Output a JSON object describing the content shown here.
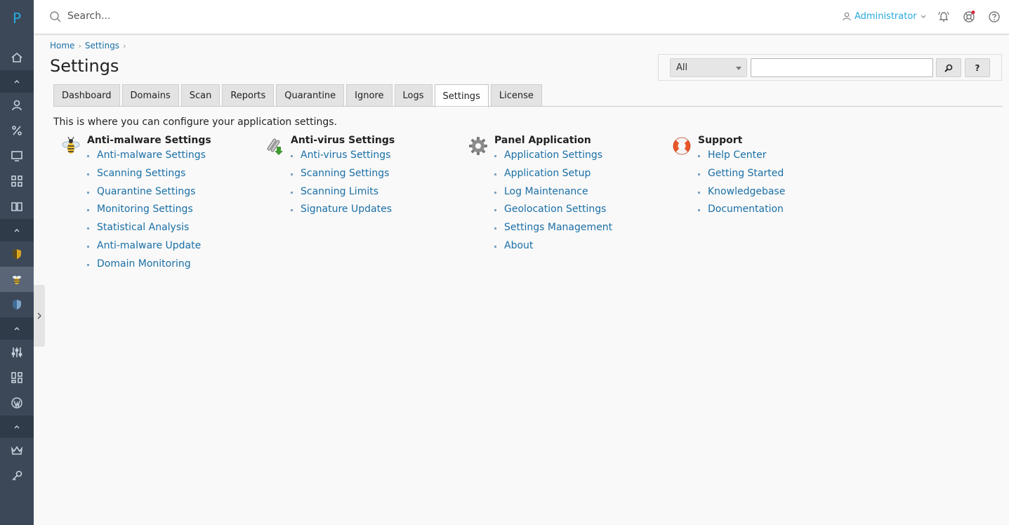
{
  "sidebar": {
    "logo": "P",
    "items": [
      {
        "name": "home-icon"
      },
      {
        "name": "user-icon"
      },
      {
        "name": "percent-icon"
      },
      {
        "name": "monitor-icon"
      },
      {
        "name": "apps-grid-icon"
      },
      {
        "name": "book-icon"
      },
      {
        "name": "shield-yellow-icon"
      },
      {
        "name": "bee-icon"
      },
      {
        "name": "shield-blue-icon"
      },
      {
        "name": "sliders-icon"
      },
      {
        "name": "modules-icon"
      },
      {
        "name": "wordpress-icon"
      },
      {
        "name": "crown-icon"
      },
      {
        "name": "key-icon"
      }
    ],
    "colors": {
      "bg": "#3c4858",
      "accent": "#28aade"
    }
  },
  "header": {
    "search_placeholder": "Search...",
    "user_label": "Administrator",
    "icons": [
      "notifications-icon",
      "help-wheel-icon",
      "question-icon"
    ]
  },
  "breadcrumb": {
    "home": "Home",
    "settings": "Settings"
  },
  "page": {
    "title": "Settings",
    "intro": "This is where you can configure your application settings."
  },
  "filter": {
    "select_value": "All",
    "search_button_icon": "search-icon",
    "help_button_label": "?"
  },
  "tabs": [
    {
      "label": "Dashboard",
      "active": false
    },
    {
      "label": "Domains",
      "active": false
    },
    {
      "label": "Scan",
      "active": false
    },
    {
      "label": "Reports",
      "active": false
    },
    {
      "label": "Quarantine",
      "active": false
    },
    {
      "label": "Ignore",
      "active": false
    },
    {
      "label": "Logs",
      "active": false
    },
    {
      "label": "Settings",
      "active": true
    },
    {
      "label": "License",
      "active": false
    }
  ],
  "sections": [
    {
      "title": "Anti-malware Settings",
      "icon": "bee-icon",
      "links": [
        "Anti-malware Settings",
        "Scanning Settings",
        "Quarantine Settings",
        "Monitoring Settings",
        "Statistical Analysis",
        "Anti-malware Update",
        "Domain Monitoring"
      ]
    },
    {
      "title": "Anti-virus Settings",
      "icon": "chain-download-icon",
      "links": [
        "Anti-virus Settings",
        "Scanning Settings",
        "Scanning Limits",
        "Signature Updates"
      ]
    },
    {
      "title": "Panel Application",
      "icon": "gear-icon",
      "links": [
        "Application Settings",
        "Application Setup",
        "Log Maintenance",
        "Geolocation Settings",
        "Settings Management",
        "About"
      ]
    },
    {
      "title": "Support",
      "icon": "lifebuoy-icon",
      "links": [
        "Help Center",
        "Getting Started",
        "Knowledgebase",
        "Documentation"
      ]
    }
  ]
}
